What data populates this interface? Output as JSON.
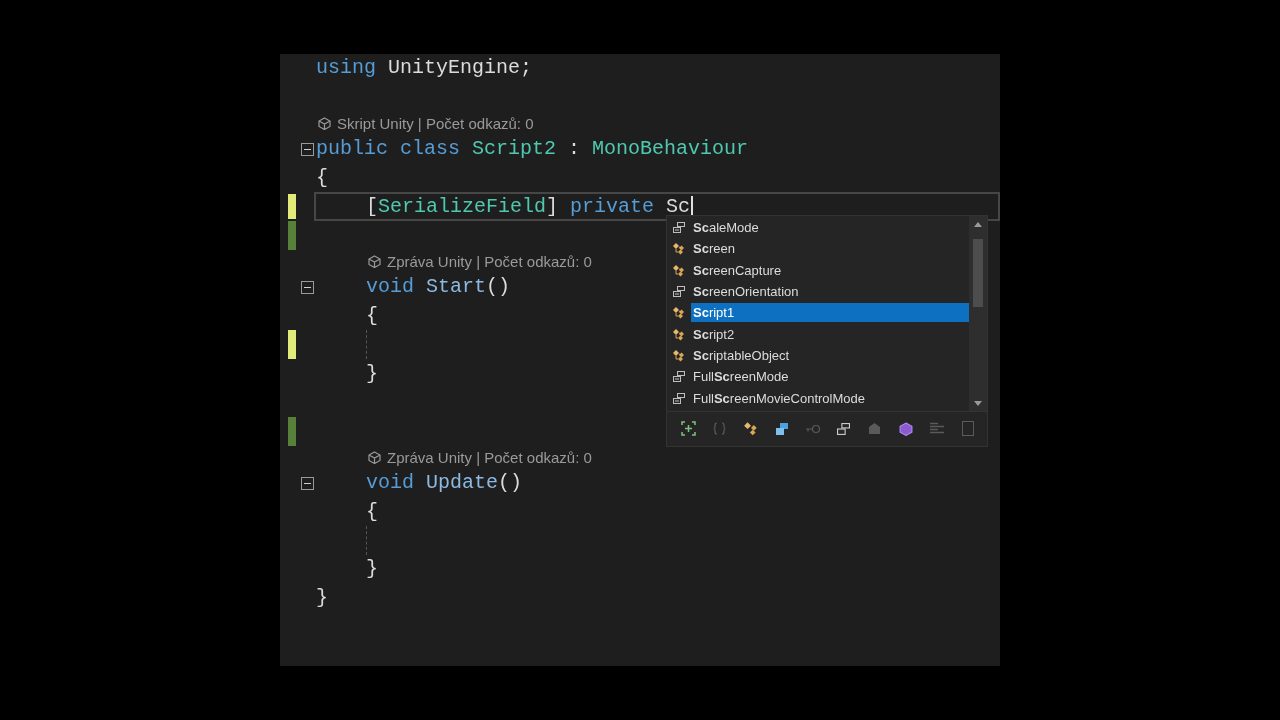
{
  "editor": {
    "lines": [
      {
        "kind": "code",
        "tokens": [
          {
            "t": "using ",
            "kind": "keyword"
          },
          {
            "t": "UnityEngine;",
            "kind": "plain"
          }
        ]
      },
      {
        "kind": "blank"
      },
      {
        "kind": "lens",
        "text": "Skript Unity | Počet odkazů: 0"
      },
      {
        "kind": "code",
        "fold": true,
        "tokens": [
          {
            "t": "public ",
            "kind": "keyword"
          },
          {
            "t": "class ",
            "kind": "keyword"
          },
          {
            "t": "Script2",
            "kind": "type"
          },
          {
            "t": " : ",
            "kind": "plain"
          },
          {
            "t": "MonoBehaviour",
            "kind": "type"
          }
        ]
      },
      {
        "kind": "code",
        "tokens": [
          {
            "t": "{",
            "kind": "plain"
          }
        ],
        "children": [
          {
            "kind": "code",
            "current": true,
            "caret": true,
            "modified": true,
            "saved": false,
            "tokens": [
              {
                "t": "[",
                "kind": "plain"
              },
              {
                "t": "SerializeField",
                "kind": "type"
              },
              {
                "t": "] ",
                "kind": "plain"
              },
              {
                "t": "private ",
                "kind": "keyword"
              },
              {
                "t": "Sc",
                "kind": "plain"
              }
            ]
          },
          {
            "kind": "blank",
            "modified": true,
            "saved": true
          },
          {
            "kind": "lens",
            "text": "Zpráva Unity | Počet odkazů: 0"
          },
          {
            "kind": "code",
            "fold": true,
            "tokens": [
              {
                "t": "void ",
                "kind": "keyword"
              },
              {
                "t": "Start",
                "kind": "method"
              },
              {
                "t": "()",
                "kind": "plain"
              }
            ]
          },
          {
            "kind": "code",
            "tokens": [
              {
                "t": "{",
                "kind": "plain"
              }
            ],
            "children": [
              {
                "kind": "blank",
                "modified": true,
                "saved": false
              }
            ]
          },
          {
            "kind": "code",
            "tokens": [
              {
                "t": "}",
                "kind": "plain"
              }
            ]
          },
          {
            "kind": "blank"
          },
          {
            "kind": "blank",
            "modified": true,
            "saved": true
          },
          {
            "kind": "lens",
            "text": "Zpráva Unity | Počet odkazů: 0"
          },
          {
            "kind": "code",
            "fold": true,
            "tokens": [
              {
                "t": "void ",
                "kind": "keyword"
              },
              {
                "t": "Update",
                "kind": "method"
              },
              {
                "t": "()",
                "kind": "plain"
              }
            ]
          },
          {
            "kind": "code",
            "tokens": [
              {
                "t": "{",
                "kind": "plain"
              }
            ],
            "children": [
              {
                "kind": "blank"
              }
            ]
          },
          {
            "kind": "code",
            "tokens": [
              {
                "t": "}",
                "kind": "plain"
              }
            ]
          }
        ]
      },
      {
        "kind": "code",
        "tokens": [
          {
            "t": "}",
            "kind": "plain"
          }
        ]
      }
    ]
  },
  "completion": {
    "items": [
      {
        "label": "**Sc**aleMode",
        "kind": "enum",
        "selected": false
      },
      {
        "label": "**Sc**reen",
        "kind": "class",
        "selected": false
      },
      {
        "label": "**Sc**reenCapture",
        "kind": "class",
        "selected": false
      },
      {
        "label": "**Sc**reenOrientation",
        "kind": "enum",
        "selected": false
      },
      {
        "label": "**Sc**ript1",
        "kind": "class",
        "selected": true
      },
      {
        "label": "**Sc**ript2",
        "kind": "class",
        "selected": false
      },
      {
        "label": "**Sc**riptableObject",
        "kind": "class",
        "selected": false
      },
      {
        "label": "Full**Sc**reenMode",
        "kind": "enum",
        "selected": false
      },
      {
        "label": "Full**Sc**reenMovieControlMode",
        "kind": "enum",
        "selected": false
      }
    ],
    "filters": [
      {
        "kind": "expand",
        "dimmed": false
      },
      {
        "kind": "namespace",
        "dimmed": true
      },
      {
        "kind": "class",
        "dimmed": false
      },
      {
        "kind": "struct",
        "dimmed": false
      },
      {
        "kind": "key",
        "dimmed": true
      },
      {
        "kind": "enum",
        "dimmed": false
      },
      {
        "kind": "building",
        "dimmed": true
      },
      {
        "kind": "cube",
        "dimmed": false
      },
      {
        "kind": "list",
        "dimmed": true
      },
      {
        "kind": "panel",
        "dimmed": true
      }
    ]
  }
}
